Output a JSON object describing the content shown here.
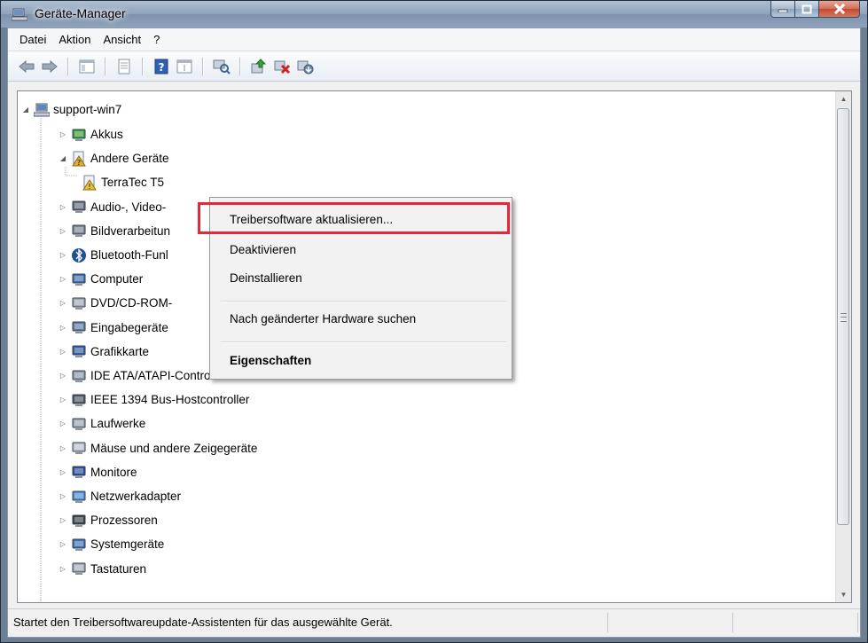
{
  "window": {
    "title": "Geräte-Manager"
  },
  "menubar": {
    "items": [
      "Datei",
      "Aktion",
      "Ansicht",
      "?"
    ]
  },
  "toolbar": {
    "buttons": [
      "back-arrow-icon",
      "forward-arrow-icon",
      "console-tree-icon",
      "properties-icon",
      "help-icon",
      "view-icon",
      "scan-hardware-icon",
      "update-driver-icon",
      "disable-device-icon",
      "uninstall-device-icon"
    ]
  },
  "tree": {
    "root": "support-win7",
    "items": [
      {
        "label": "Akkus",
        "level": 1,
        "expander": "collapsed",
        "icon": "battery-icon"
      },
      {
        "label": "Andere Geräte",
        "level": 1,
        "expander": "expanded",
        "icon": "unknown-device-icon"
      },
      {
        "label": "TerraTec T5",
        "level": 2,
        "expander": "none",
        "icon": "warning-device-icon"
      },
      {
        "label": "Audio-, Video-",
        "level": 1,
        "expander": "collapsed",
        "icon": "speaker-icon"
      },
      {
        "label": "Bildverarbeitun",
        "level": 1,
        "expander": "collapsed",
        "icon": "camera-icon"
      },
      {
        "label": "Bluetooth-Funl",
        "level": 1,
        "expander": "collapsed",
        "icon": "bluetooth-icon"
      },
      {
        "label": "Computer",
        "level": 1,
        "expander": "collapsed",
        "icon": "computer-icon"
      },
      {
        "label": "DVD/CD-ROM-",
        "level": 1,
        "expander": "collapsed",
        "icon": "dvd-drive-icon"
      },
      {
        "label": "Eingabegeräte",
        "level": 1,
        "expander": "collapsed",
        "icon": "input-device-icon"
      },
      {
        "label": "Grafikkarte",
        "level": 1,
        "expander": "collapsed",
        "icon": "graphics-card-icon"
      },
      {
        "label": "IDE ATA/ATAPI-Controller",
        "level": 1,
        "expander": "collapsed",
        "icon": "ide-controller-icon"
      },
      {
        "label": "IEEE 1394 Bus-Hostcontroller",
        "level": 1,
        "expander": "collapsed",
        "icon": "firewire-icon"
      },
      {
        "label": "Laufwerke",
        "level": 1,
        "expander": "collapsed",
        "icon": "disk-drive-icon"
      },
      {
        "label": "Mäuse und andere Zeigegeräte",
        "level": 1,
        "expander": "collapsed",
        "icon": "mouse-icon"
      },
      {
        "label": "Monitore",
        "level": 1,
        "expander": "collapsed",
        "icon": "monitor-icon"
      },
      {
        "label": "Netzwerkadapter",
        "level": 1,
        "expander": "collapsed",
        "icon": "network-adapter-icon"
      },
      {
        "label": "Prozessoren",
        "level": 1,
        "expander": "collapsed",
        "icon": "processor-icon"
      },
      {
        "label": "Systemgeräte",
        "level": 1,
        "expander": "collapsed",
        "icon": "system-device-icon"
      },
      {
        "label": "Tastaturen",
        "level": 1,
        "expander": "collapsed",
        "icon": "keyboard-icon"
      }
    ]
  },
  "context_menu": {
    "items": [
      {
        "label": "Treibersoftware aktualisieren...",
        "bold": false,
        "highlighted": true
      },
      {
        "label": "Deaktivieren",
        "bold": false
      },
      {
        "label": "Deinstallieren",
        "bold": false
      },
      {
        "label": "Nach geänderter Hardware suchen",
        "bold": false
      },
      {
        "label": "Eigenschaften",
        "bold": true
      }
    ]
  },
  "statusbar": {
    "text": "Startet den Treibersoftwareupdate-Assistenten für das ausgewählte Gerät."
  },
  "colors": {
    "highlight": "#e8263a",
    "titlebar": "#8ea2b9",
    "close_button": "#c04a30"
  }
}
